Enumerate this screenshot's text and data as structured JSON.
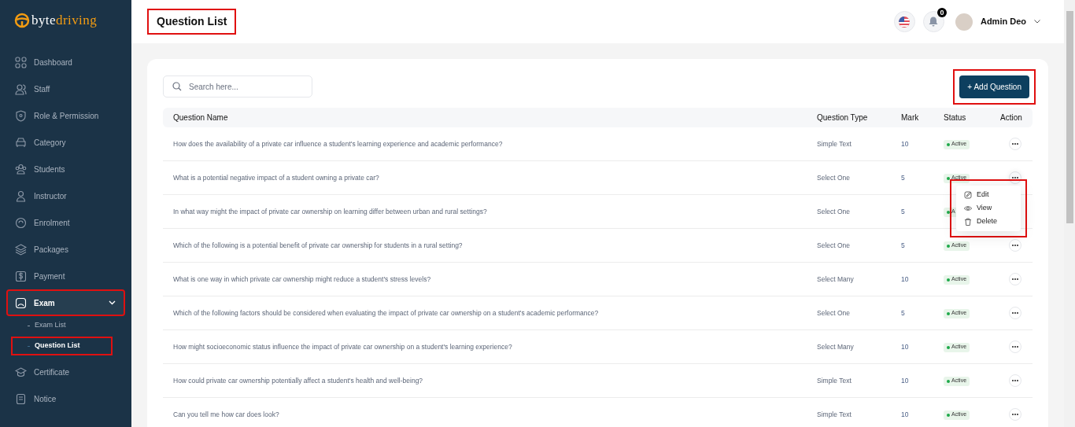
{
  "brand": {
    "part_1": "byte",
    "part_2": "driving"
  },
  "sidebar": {
    "items": [
      {
        "label": "Dashboard",
        "selected": false
      },
      {
        "label": "Staff",
        "selected": false
      },
      {
        "label": "Role & Permission",
        "selected": false
      },
      {
        "label": "Category",
        "selected": false
      },
      {
        "label": "Students",
        "selected": false
      },
      {
        "label": "Instructor",
        "selected": false
      },
      {
        "label": "Enrolment",
        "selected": false
      },
      {
        "label": "Packages",
        "selected": false
      },
      {
        "label": "Payment",
        "selected": false
      },
      {
        "label": "Exam",
        "selected": true,
        "expanded": true,
        "highlighted": true,
        "children": [
          {
            "label": "Exam List",
            "selected": false,
            "highlighted": false
          },
          {
            "label": "Question List",
            "selected": true,
            "highlighted": true
          }
        ]
      },
      {
        "label": "Certificate",
        "selected": false
      },
      {
        "label": "Notice",
        "selected": false
      }
    ]
  },
  "header": {
    "title": "Question List",
    "title_highlighted": true,
    "notification_count": "0",
    "user_name": "Admin Deo"
  },
  "search": {
    "placeholder": "Search here..."
  },
  "add_button": {
    "label": "+ Add Question",
    "highlighted": true
  },
  "table": {
    "columns": [
      "Question Name",
      "Question Type",
      "Mark",
      "Status",
      "Action"
    ],
    "rows": [
      {
        "name": "How does the availability of a private car influence a student's learning experience and academic performance?",
        "type": "Simple Text",
        "mark": "10",
        "status": "Active",
        "menu_open": false
      },
      {
        "name": "What is a potential negative impact of a student owning a private car?",
        "type": "Select One",
        "mark": "5",
        "status": "Active",
        "menu_open": true
      },
      {
        "name": "In what way might the impact of private car ownership on learning differ between urban and rural settings?",
        "type": "Select One",
        "mark": "5",
        "status": "A"
      },
      {
        "name": "Which of the following is a potential benefit of private car ownership for students in a rural setting?",
        "type": "Select One",
        "mark": "5",
        "status": "Active",
        "menu_open": false
      },
      {
        "name": "What is one way in which private car ownership might reduce a student's stress levels?",
        "type": "Select Many",
        "mark": "10",
        "status": "Active",
        "menu_open": false
      },
      {
        "name": "Which of the following factors should be considered when evaluating the impact of private car ownership on a student's academic performance?",
        "type": "Select One",
        "mark": "5",
        "status": "Active",
        "menu_open": false
      },
      {
        "name": "How might socioeconomic status influence the impact of private car ownership on a student's learning experience?",
        "type": "Select Many",
        "mark": "10",
        "status": "Active",
        "menu_open": false
      },
      {
        "name": "How could private car ownership potentially affect a student's health and well-being?",
        "type": "Simple Text",
        "mark": "10",
        "status": "Active",
        "menu_open": false
      },
      {
        "name": "Can you tell me how car does look?",
        "type": "Simple Text",
        "mark": "10",
        "status": "Active",
        "menu_open": false
      }
    ]
  },
  "action_menu": {
    "highlighted": true,
    "items": [
      {
        "label": "Edit",
        "kind": "edit"
      },
      {
        "label": "View",
        "kind": "view"
      },
      {
        "label": "Delete",
        "kind": "delete"
      }
    ]
  }
}
